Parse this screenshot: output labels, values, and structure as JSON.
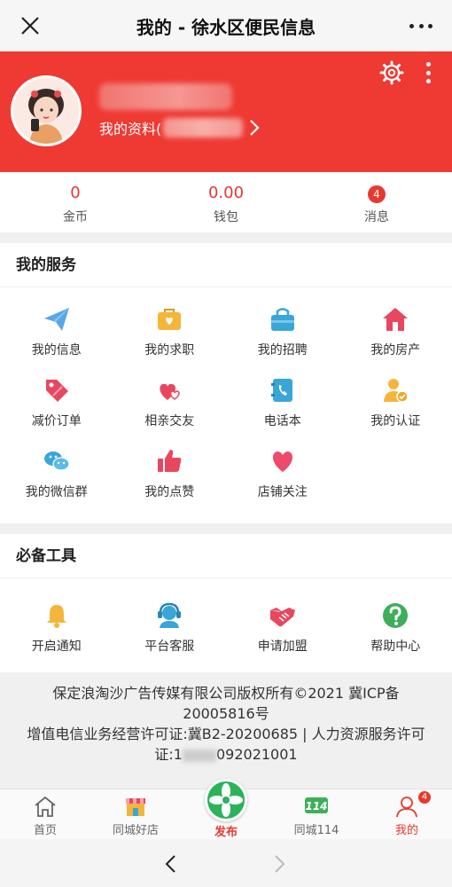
{
  "nav": {
    "title": "我的 - 徐水区便民信息"
  },
  "profile": {
    "link_label": "我的资料("
  },
  "stats": [
    {
      "value": "0",
      "label": "金币"
    },
    {
      "value": "0.00",
      "label": "钱包"
    },
    {
      "badge": "4",
      "label": "消息"
    }
  ],
  "services": {
    "title": "我的服务",
    "items": [
      {
        "label": "我的信息",
        "icon": "paper-plane-icon"
      },
      {
        "label": "我的求职",
        "icon": "briefcase-heart-icon"
      },
      {
        "label": "我的招聘",
        "icon": "shopping-bag-icon"
      },
      {
        "label": "我的房产",
        "icon": "house-icon"
      },
      {
        "label": "减价订单",
        "icon": "price-tag-icon"
      },
      {
        "label": "相亲交友",
        "icon": "hearts-icon"
      },
      {
        "label": "电话本",
        "icon": "phonebook-icon"
      },
      {
        "label": "我的认证",
        "icon": "verified-user-icon"
      },
      {
        "label": "我的微信群",
        "icon": "wechat-icon"
      },
      {
        "label": "我的点赞",
        "icon": "thumbs-up-icon"
      },
      {
        "label": "店铺关注",
        "icon": "heart-icon"
      }
    ]
  },
  "tools": {
    "title": "必备工具",
    "items": [
      {
        "label": "开启通知",
        "icon": "bell-icon"
      },
      {
        "label": "平台客服",
        "icon": "headset-icon"
      },
      {
        "label": "申请加盟",
        "icon": "handshake-icon"
      },
      {
        "label": "帮助中心",
        "icon": "question-icon"
      }
    ]
  },
  "footer": {
    "line1": "保定浪淘沙广告传媒有限公司版权所有©2021 冀ICP备20005816号",
    "line2a": "增值电信业务经营许可证:冀B2-20200685 | 人力资源服务许可证:1",
    "line2b": "092021001"
  },
  "tabs": [
    {
      "label": "首页",
      "icon": "home-icon"
    },
    {
      "label": "同城好店",
      "icon": "store-icon"
    },
    {
      "label": "发布",
      "icon": "publish-fan-icon"
    },
    {
      "label": "同城114",
      "icon": "directory-114-icon"
    },
    {
      "label": "我的",
      "icon": "user-icon",
      "badge": "4"
    }
  ],
  "colors": {
    "brand_red": "#ee3a33",
    "accent_green": "#2bb35a"
  }
}
